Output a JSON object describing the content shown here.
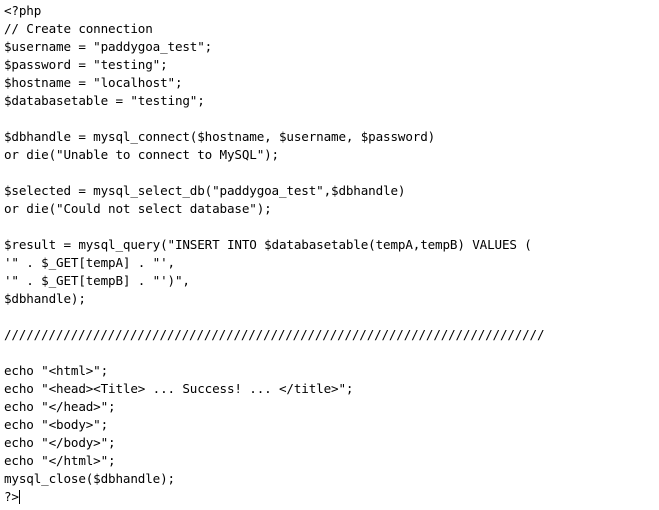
{
  "document": {
    "language": "PHP",
    "background_color": "#ffffff",
    "text_color": "#000000",
    "caret_visible": true,
    "lines": [
      "<?php",
      "// Create connection",
      "$username = \"paddygoa_test\";",
      "$password = \"testing\";",
      "$hostname = \"localhost\";",
      "$databasetable = \"testing\";",
      "",
      "$dbhandle = mysql_connect($hostname, $username, $password)",
      "or die(\"Unable to connect to MySQL\");",
      "",
      "$selected = mysql_select_db(\"paddygoa_test\",$dbhandle)",
      "or die(\"Could not select database\");",
      "",
      "$result = mysql_query(\"INSERT INTO $databasetable(tempA,tempB) VALUES (",
      "'\" . $_GET[tempA] . \"',",
      "'\" . $_GET[tempB] . \"')\",",
      "$dbhandle);",
      "",
      "/////////////////////////////////////////////////////////////////////////",
      "",
      "echo \"<html>\";",
      "echo \"<head><Title> ... Success! ... </title>\";",
      "echo \"</head>\";",
      "echo \"<body>\";",
      "echo \"</body>\";",
      "echo \"</html>\";",
      "mysql_close($dbhandle);",
      "?>"
    ]
  }
}
